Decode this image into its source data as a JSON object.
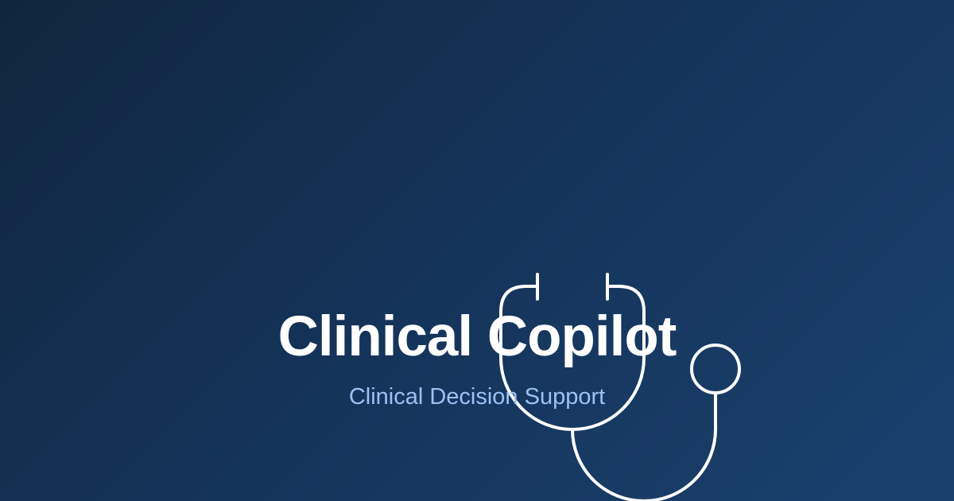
{
  "hero": {
    "title": "Clinical Copilot",
    "subtitle": "Clinical Decision Support"
  },
  "colors": {
    "background_start": "#10263f",
    "background_end": "#1a416d",
    "title": "#ffffff",
    "subtitle": "#9ec1f3",
    "icon_stroke": "#ffffff"
  },
  "icons": {
    "stethoscope": "stethoscope-icon"
  }
}
